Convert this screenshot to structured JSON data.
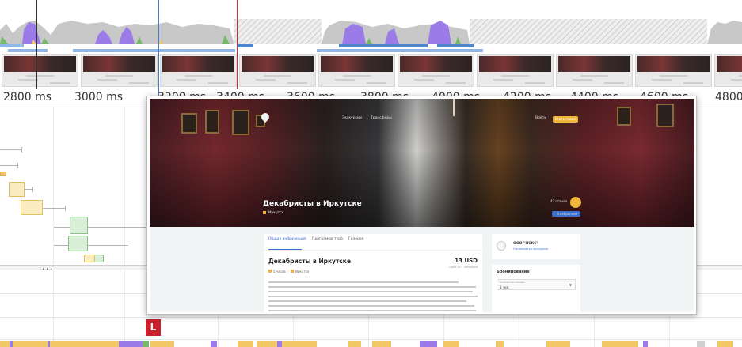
{
  "timeline": {
    "ruler_ticks": [
      "2800 ms",
      "3000 ms",
      "3200 ms",
      "3400 ms",
      "3600 ms",
      "3800 ms",
      "4000 ms",
      "4200 ms",
      "4400 ms",
      "4600 ms",
      "4800"
    ],
    "colors": {
      "scripting": "#f2c766",
      "rendering": "#9b7be8",
      "painting": "#79b86a",
      "idle": "#c8c8c8",
      "network": "#8fb6e6",
      "cursor": "#3a7fd6",
      "selection": "#c63333",
      "marker": "#c8232c"
    },
    "splitter_label": "...",
    "marker_label": "L"
  },
  "screenshot": {
    "nav": [
      "Экскурсии",
      "Трансферы",
      "Войти"
    ],
    "nav_button": "Стать гидом",
    "hero_title": "Декабристы в Иркутске",
    "hero_location": "Иркутск",
    "hero_rating": "42 отзыва",
    "hero_button": "В избранное",
    "tabs": [
      "Общая информация",
      "Программа тура",
      "Галерея"
    ],
    "card_title": "Декабристы в Иркутске",
    "price": "13 USD",
    "price_sub": "цена за 1 человека",
    "tags": [
      "5 часов",
      "Иркутск"
    ],
    "org_name": "ООО \"НСКС\"",
    "org_sub": "Организатор экскурсии",
    "booking_title": "Бронирование",
    "select_label": "Количество человек",
    "select_value": "1 чел."
  }
}
